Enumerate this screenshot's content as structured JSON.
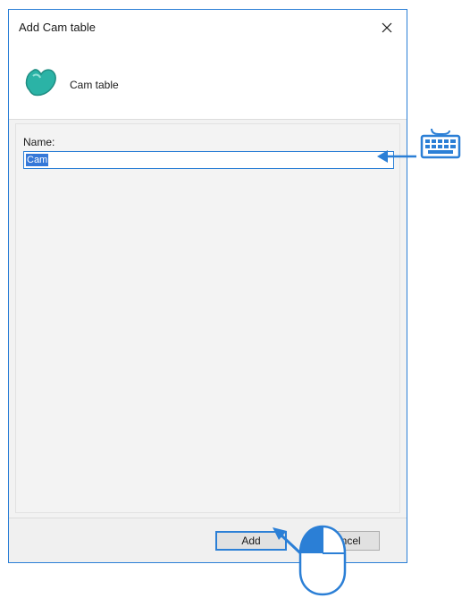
{
  "dialog": {
    "title": "Add Cam table",
    "close_glyph": "✕",
    "header_label": "Cam table",
    "header_icon": "cam-table-icon"
  },
  "form": {
    "name_label": "Name:",
    "name_value": "Cam"
  },
  "buttons": {
    "add_label": "Add",
    "cancel_label": "Cancel"
  },
  "annotations": {
    "keyboard_icon": "keyboard-icon",
    "mouse_icon": "mouse-icon",
    "arrow_color": "#2b7fd6"
  },
  "colors": {
    "accent": "#2b7fd6",
    "selection": "#3578d8",
    "icon_teal": "#2bb3a6"
  }
}
